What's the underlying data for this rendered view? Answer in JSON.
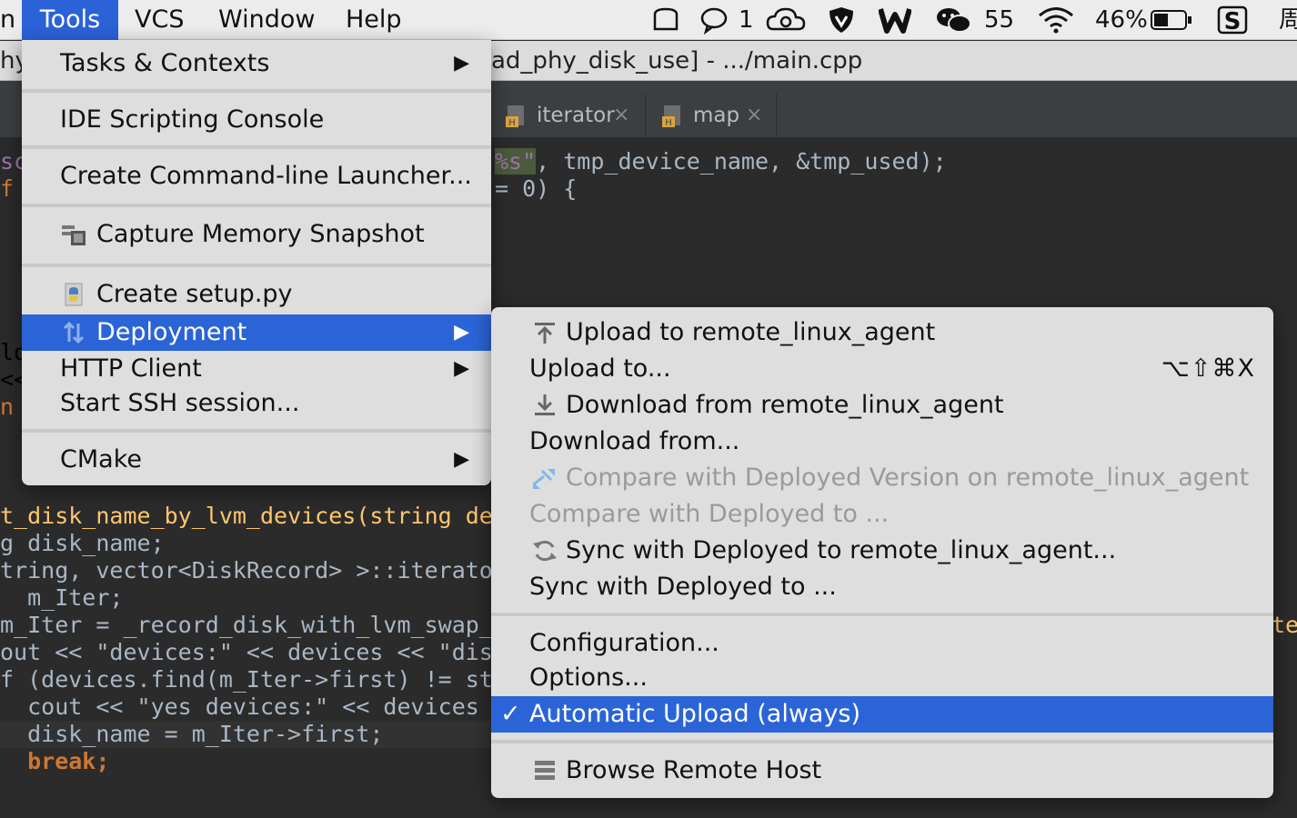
{
  "menubar": {
    "partial_left": "n",
    "tools": "Tools",
    "vcs": "VCS",
    "window": "Window",
    "help": "Help"
  },
  "status": {
    "notif_count": "1",
    "wechat_count": "55",
    "battery": "46%",
    "partial_right": "周"
  },
  "title": {
    "left_fragment": "hy",
    "text": "ad_phy_disk_use] - .../main.cpp"
  },
  "tabs": [
    {
      "label": "iterator",
      "close": "×"
    },
    {
      "label": "map",
      "close": "×"
    }
  ],
  "tools_menu": {
    "items": [
      {
        "label": "Tasks & Contexts",
        "arrow": "▶"
      },
      {
        "label": "IDE Scripting Console"
      },
      {
        "label": "Create Command-line Launcher..."
      },
      {
        "label": "Capture Memory Snapshot"
      },
      {
        "label": "Create setup.py"
      },
      {
        "label": "Deployment",
        "arrow": "▶"
      },
      {
        "label": "HTTP Client",
        "arrow": "▶"
      },
      {
        "label": "Start SSH session..."
      },
      {
        "label": "CMake",
        "arrow": "▶"
      }
    ]
  },
  "deploy_menu": {
    "items": [
      {
        "label": "Upload to remote_linux_agent"
      },
      {
        "label": "Upload to...",
        "shortcut": "⌥⇧⌘X"
      },
      {
        "label": "Download from remote_linux_agent"
      },
      {
        "label": "Download from..."
      },
      {
        "label": "Compare with Deployed Version on remote_linux_agent"
      },
      {
        "label": "Compare with Deployed to ..."
      },
      {
        "label": "Sync with Deployed to remote_linux_agent..."
      },
      {
        "label": "Sync with Deployed to ..."
      },
      {
        "label": "Configuration..."
      },
      {
        "label": "Options..."
      },
      {
        "label": "Automatic Upload (always)",
        "check": "✓"
      },
      {
        "label": "Browse Remote Host"
      }
    ]
  },
  "code": {
    "l1_a": "%s\"",
    "l1_b": ", tmp_device_name, &tmp_used);",
    "l2": "= 0) {",
    "right_frag": "te",
    "lines": [
      "t_disk_name_by_lvm_devices(string devic",
      "g disk_name;",
      "tring, vector<DiskRecord> >::iterator",
      "  m_Iter;",
      "m_Iter = _record_disk_with_lvm_swap_map",
      "out << \"devices:\" << devices << \"disk_r",
      "f (devices.find(m_Iter->first) != strin",
      "  cout << \"yes devices:\" << devices <<",
      "  disk_name = m_Iter->first;",
      "  break;"
    ],
    "gutter": [
      "sc",
      "f",
      "lo",
      "<<",
      "n"
    ]
  },
  "colors": {
    "menu_bg": "#dedede",
    "selection": "#2b64d6",
    "editor_bg": "#2b2b2b"
  }
}
